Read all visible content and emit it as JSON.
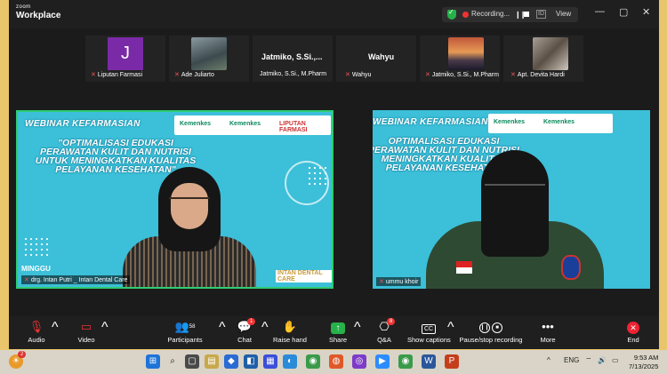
{
  "app": {
    "brand_small": "zoom",
    "brand_name": "Workplace"
  },
  "recording": {
    "label": "Recording...",
    "view_label": "View"
  },
  "window_controls": {
    "minimize": "—",
    "maximize": "▢",
    "close": "✕"
  },
  "participants_strip": [
    {
      "avatar_letter": "J",
      "label": "Liputan Farmasi",
      "avatar_color": "#7a2aa6"
    },
    {
      "label": "Ade Juliarto"
    },
    {
      "display_name": "Jatmiko,  S.Si.,...",
      "label": "Jatmiko, S.Si., M.Pharm"
    },
    {
      "display_name": "Wahyu",
      "label": "Wahyu"
    },
    {
      "label": "Jatmiko, S.Si., M.Pharm"
    },
    {
      "label": "Apt. Devita Hardi"
    }
  ],
  "left_video": {
    "banner_title": "WEBINAR KEFARMASIAN",
    "logo_1": "Kemenkes",
    "logo_2": "Kemenkes",
    "logo_3": "LIPUTAN FARMASI",
    "title_line_1": "\"OPTIMALISASI EDUKASI",
    "title_line_2": "PERAWATAN KULIT DAN NUTRISI",
    "title_line_3": "UNTUK MENINGKATKAN KUALITAS",
    "title_line_4": "PELAYANAN KESEHATAN\"",
    "day_label": "MINGGU",
    "watermark": "INTAN DENTAL CARE",
    "participant_name": "drg. Intan Putri _ Intan Dental Care"
  },
  "right_video": {
    "banner_title": "WEBINAR KEFARMASIAN",
    "logo_1": "Kemenkes",
    "logo_2": "Kemenkes",
    "title_line_1": "OPTIMALISASI EDUKASI",
    "title_line_2": "PERAWATAN KULIT DAN NUTRISI",
    "title_line_3": "MENINGKATKAN KUALITAS",
    "title_line_4": "PELAYANAN KESEHATAN",
    "participant_name": "ummu khoir"
  },
  "toolbar": {
    "audio": "Audio",
    "video": "Video",
    "participants": "Participants",
    "participants_count": "58",
    "chat": "Chat",
    "chat_badge": "1",
    "raise_hand": "Raise hand",
    "share": "Share",
    "qa": "Q&A",
    "qa_badge": "8",
    "captions": "Show captions",
    "recording": "Pause/stop recording",
    "more": "More",
    "end": "End"
  },
  "taskbar": {
    "notif_badge": "2",
    "language": "ENG",
    "time": "9:53 AM",
    "date": "7/13/2025"
  },
  "colors": {
    "accent_green": "#27b14a",
    "end_red": "#e22233",
    "slide_cyan": "#3cbfd8"
  }
}
